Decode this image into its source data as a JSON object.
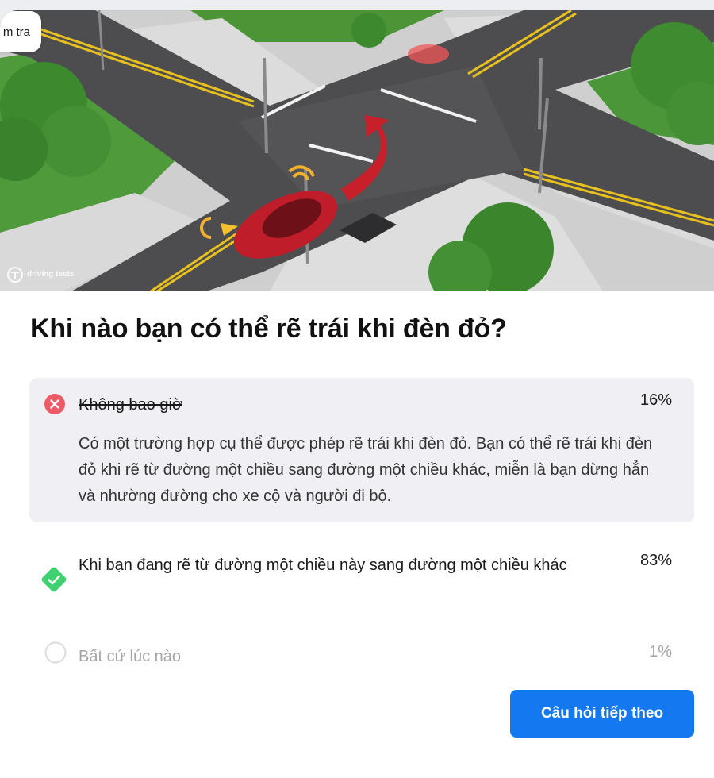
{
  "nav": {
    "back_label": "m tra"
  },
  "hero": {
    "logo_text": "driving tests"
  },
  "question": {
    "text": "Khi nào bạn có thể rẽ trái khi đèn đỏ?"
  },
  "answers": [
    {
      "text": "Không bao giờ",
      "percent": "16%",
      "state": "wrong",
      "explanation": "Có một trường hợp cụ thể được phép rẽ trái khi đèn đỏ. Bạn có thể rẽ trái khi đèn đỏ khi rẽ từ đường một chiều sang đường một chiều khác, miễn là bạn dừng hẳn và nhường đường cho xe cộ và người đi bộ."
    },
    {
      "text": "Khi bạn đang rẽ từ đường một chiều này sang đường một chiều khác",
      "percent": "83%",
      "state": "correct"
    },
    {
      "text": "Bất cứ lúc nào",
      "percent": "1%",
      "state": "unselected"
    }
  ],
  "next_button": {
    "label": "Câu hỏi tiếp theo"
  },
  "colors": {
    "accent": "#1478f0",
    "wrong": "#ee5a67",
    "correct": "#2ecc71",
    "wrong_bg": "#f0f0f4"
  }
}
